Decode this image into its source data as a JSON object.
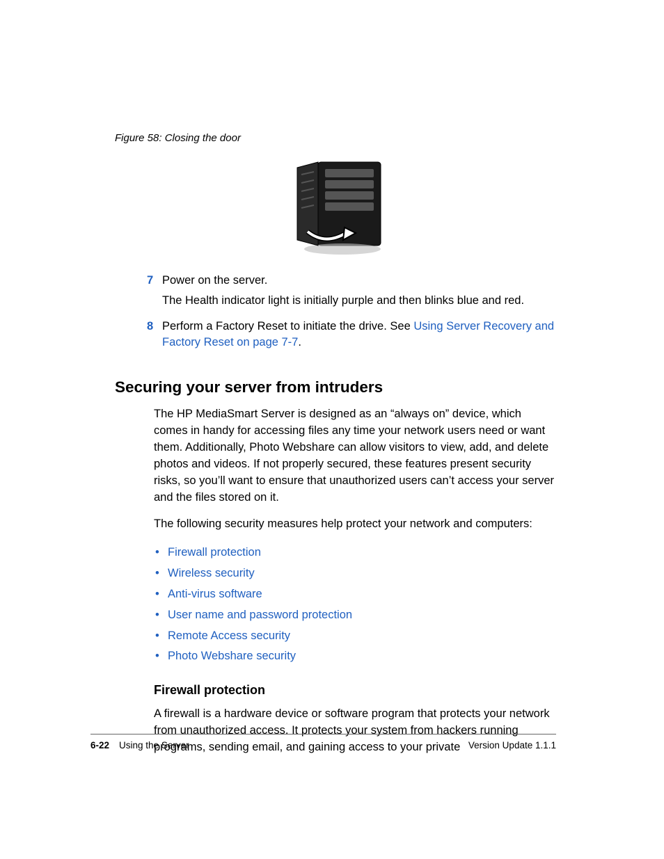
{
  "figure": {
    "caption": "Figure 58:  Closing the door"
  },
  "steps": [
    {
      "num": "7",
      "lines": [
        "Power on the server.",
        "The Health indicator light is initially purple and then blinks blue and red."
      ]
    },
    {
      "num": "8",
      "prefix": "Perform a Factory Reset to initiate the drive. See ",
      "link": "Using Server Recovery and Factory Reset on page 7-7",
      "suffix": "."
    }
  ],
  "heading": "Securing your server from intruders",
  "intro_p1": "The HP MediaSmart Server is designed as an “always on” device, which comes in handy for accessing files any time your network users need or want them. Additionally, Photo Webshare can allow visitors to view, add, and delete photos and videos. If not properly secured, these features present security risks, so you’ll want to ensure that unauthorized users can’t access your server and the files stored on it.",
  "intro_p2": "The following security measures help protect your network and computers:",
  "links": [
    "Firewall protection",
    "Wireless security",
    "Anti-virus software",
    "User name and password protection",
    "Remote Access security",
    "Photo Webshare security"
  ],
  "subheading": "Firewall protection",
  "sub_p1": "A firewall is a hardware device or software program that protects your network from unauthorized access. It protects your system from hackers running programs, sending email, and gaining access to your private",
  "footer": {
    "pagenum": "6-22",
    "section": "Using the Server",
    "version": "Version Update 1.1.1"
  }
}
